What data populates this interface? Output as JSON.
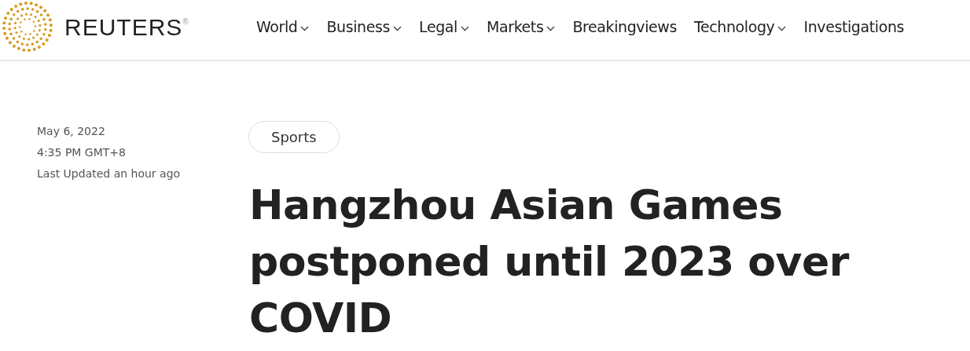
{
  "brand": {
    "name": "REUTERS",
    "mark": "®"
  },
  "nav": [
    {
      "label": "World",
      "has_menu": true
    },
    {
      "label": "Business",
      "has_menu": true
    },
    {
      "label": "Legal",
      "has_menu": true
    },
    {
      "label": "Markets",
      "has_menu": true
    },
    {
      "label": "Breakingviews",
      "has_menu": false
    },
    {
      "label": "Technology",
      "has_menu": true
    },
    {
      "label": "Investigations",
      "has_menu": false
    }
  ],
  "article": {
    "date": "May 6, 2022",
    "time": "4:35 PM GMT+8",
    "updated": "Last Updated an hour ago",
    "tag": "Sports",
    "headline": "Hangzhou Asian Games postponed until 2023 over COVID"
  }
}
